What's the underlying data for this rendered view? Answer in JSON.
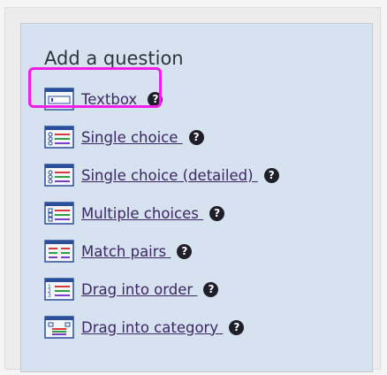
{
  "panel": {
    "title": "Add a question",
    "items": [
      {
        "label": "Textbox ",
        "icon": "textbox-question-icon",
        "help_icon": "help-icon"
      },
      {
        "label": "Single choice ",
        "icon": "single-choice-icon",
        "help_icon": "help-icon"
      },
      {
        "label": "Single choice (detailed) ",
        "icon": "single-choice-detailed-icon",
        "help_icon": "help-icon"
      },
      {
        "label": "Multiple choices ",
        "icon": "multiple-choices-icon",
        "help_icon": "help-icon"
      },
      {
        "label": "Match pairs ",
        "icon": "match-pairs-icon",
        "help_icon": "help-icon"
      },
      {
        "label": "Drag into order ",
        "icon": "drag-into-order-icon",
        "help_icon": "help-icon"
      },
      {
        "label": "Drag into category ",
        "icon": "drag-into-category-icon",
        "help_icon": "help-icon"
      }
    ],
    "help_glyph": "?"
  },
  "colors": {
    "panel_bg": "#d6e2ef",
    "link": "#3c2665",
    "highlight": "#f01ee6"
  }
}
